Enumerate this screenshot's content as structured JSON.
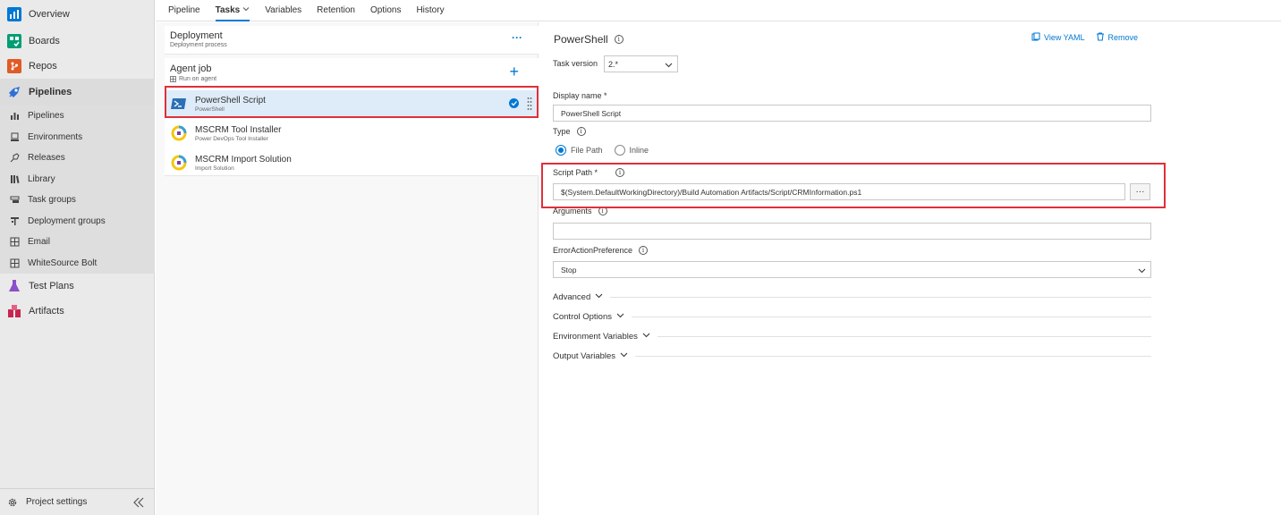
{
  "colors": {
    "accent": "#0078d4",
    "highlight": "#e0303a",
    "selected_row": "#deecf9",
    "sidebar_bg": "#eaeaea"
  },
  "sidebar": {
    "top_items": [
      {
        "label": "Overview",
        "icon": "overview-icon",
        "color": "#0078d4"
      },
      {
        "label": "Boards",
        "icon": "boards-icon",
        "color": "#009e73"
      },
      {
        "label": "Repos",
        "icon": "repos-icon",
        "color": "#e05b25"
      },
      {
        "label": "Pipelines",
        "icon": "pipelines-icon",
        "color": "#2f6fd6"
      }
    ],
    "pipeline_sub_items": [
      {
        "label": "Pipelines",
        "icon": "pipelines-bar-icon"
      },
      {
        "label": "Environments",
        "icon": "environments-icon"
      },
      {
        "label": "Releases",
        "icon": "releases-icon"
      },
      {
        "label": "Library",
        "icon": "library-icon"
      },
      {
        "label": "Task groups",
        "icon": "task-groups-icon"
      },
      {
        "label": "Deployment groups",
        "icon": "deployment-groups-icon"
      },
      {
        "label": "Email",
        "icon": "email-grid-icon"
      },
      {
        "label": "WhiteSource Bolt",
        "icon": "whitesource-grid-icon"
      }
    ],
    "bottom_items": [
      {
        "label": "Test Plans",
        "icon": "test-plans-icon",
        "color": "#8a4fc9"
      },
      {
        "label": "Artifacts",
        "icon": "artifacts-icon",
        "color": "#c7254e"
      }
    ],
    "footer_label": "Project settings"
  },
  "tabs": [
    {
      "label": "Pipeline",
      "active": false
    },
    {
      "label": "Tasks",
      "active": true
    },
    {
      "label": "Variables",
      "active": false
    },
    {
      "label": "Retention",
      "active": false
    },
    {
      "label": "Options",
      "active": false
    },
    {
      "label": "History",
      "active": false
    }
  ],
  "stage": {
    "title": "Deployment",
    "subtitle": "Deployment process",
    "more": "···"
  },
  "agent_job": {
    "title": "Agent job",
    "subtitle": "Run on agent",
    "add": "+"
  },
  "tasks": [
    {
      "name": "PowerShell Script",
      "subtitle": "PowerShell",
      "icon": "powershell-icon",
      "selected": true
    },
    {
      "name": "MSCRM Tool Installer",
      "subtitle": "Power DevOps Tool Installer",
      "icon": "mscrm-icon",
      "selected": false
    },
    {
      "name": "MSCRM Import Solution",
      "subtitle": "Import Solution",
      "icon": "mscrm-icon",
      "selected": false
    }
  ],
  "details": {
    "title": "PowerShell",
    "view_yaml": "View YAML",
    "remove": "Remove",
    "task_version_label": "Task version",
    "task_version_value": "2.*",
    "display_name_label": "Display name *",
    "display_name_value": "PowerShell Script",
    "type_label": "Type",
    "type_options": [
      "File Path",
      "Inline"
    ],
    "type_selected": "File Path",
    "script_path_label": "Script Path *",
    "script_path_value": "$(System.DefaultWorkingDirectory)/Build Automation Artifacts/Script/CRMInformation.ps1",
    "browse": "···",
    "arguments_label": "Arguments",
    "arguments_value": "",
    "error_pref_label": "ErrorActionPreference",
    "error_pref_value": "Stop",
    "sections": [
      "Advanced",
      "Control Options",
      "Environment Variables",
      "Output Variables"
    ]
  }
}
